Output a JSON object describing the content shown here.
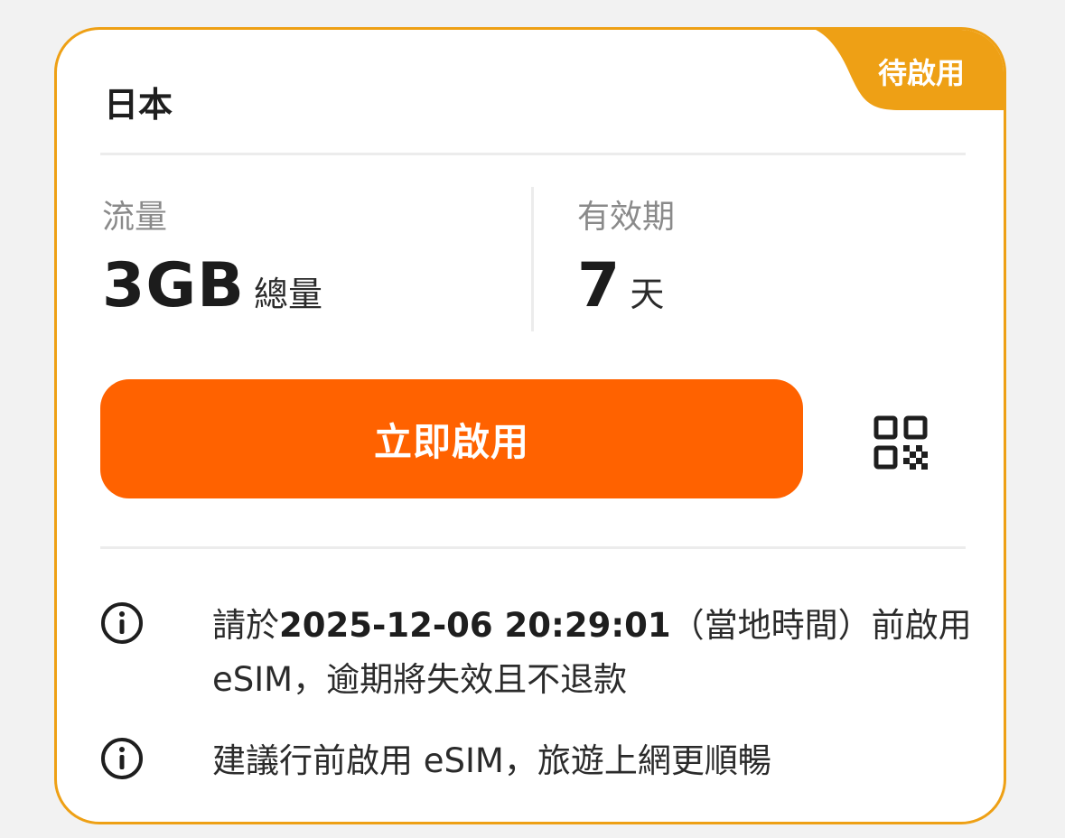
{
  "card": {
    "status": "待啟用",
    "country": "日本",
    "data": {
      "label": "流量",
      "value": "3GB",
      "unit": "總量"
    },
    "validity": {
      "label": "有效期",
      "value": "7",
      "unit": "天"
    },
    "activate_button": "立即啟用",
    "qr_icon": "qr-code-icon",
    "notes": [
      {
        "icon": "info-icon",
        "prefix": "請於",
        "datetime": "2025-12-06 20:29:01",
        "suffix": "（當地時間）前啟用 eSIM，逾期將失效且不退款"
      },
      {
        "icon": "info-icon",
        "text": "建議行前啟用 eSIM，旅遊上網更順暢"
      }
    ]
  },
  "colors": {
    "accent": "#ff6200",
    "border": "#eea015",
    "badge": "#eea015",
    "background": "#f2f2f2"
  }
}
